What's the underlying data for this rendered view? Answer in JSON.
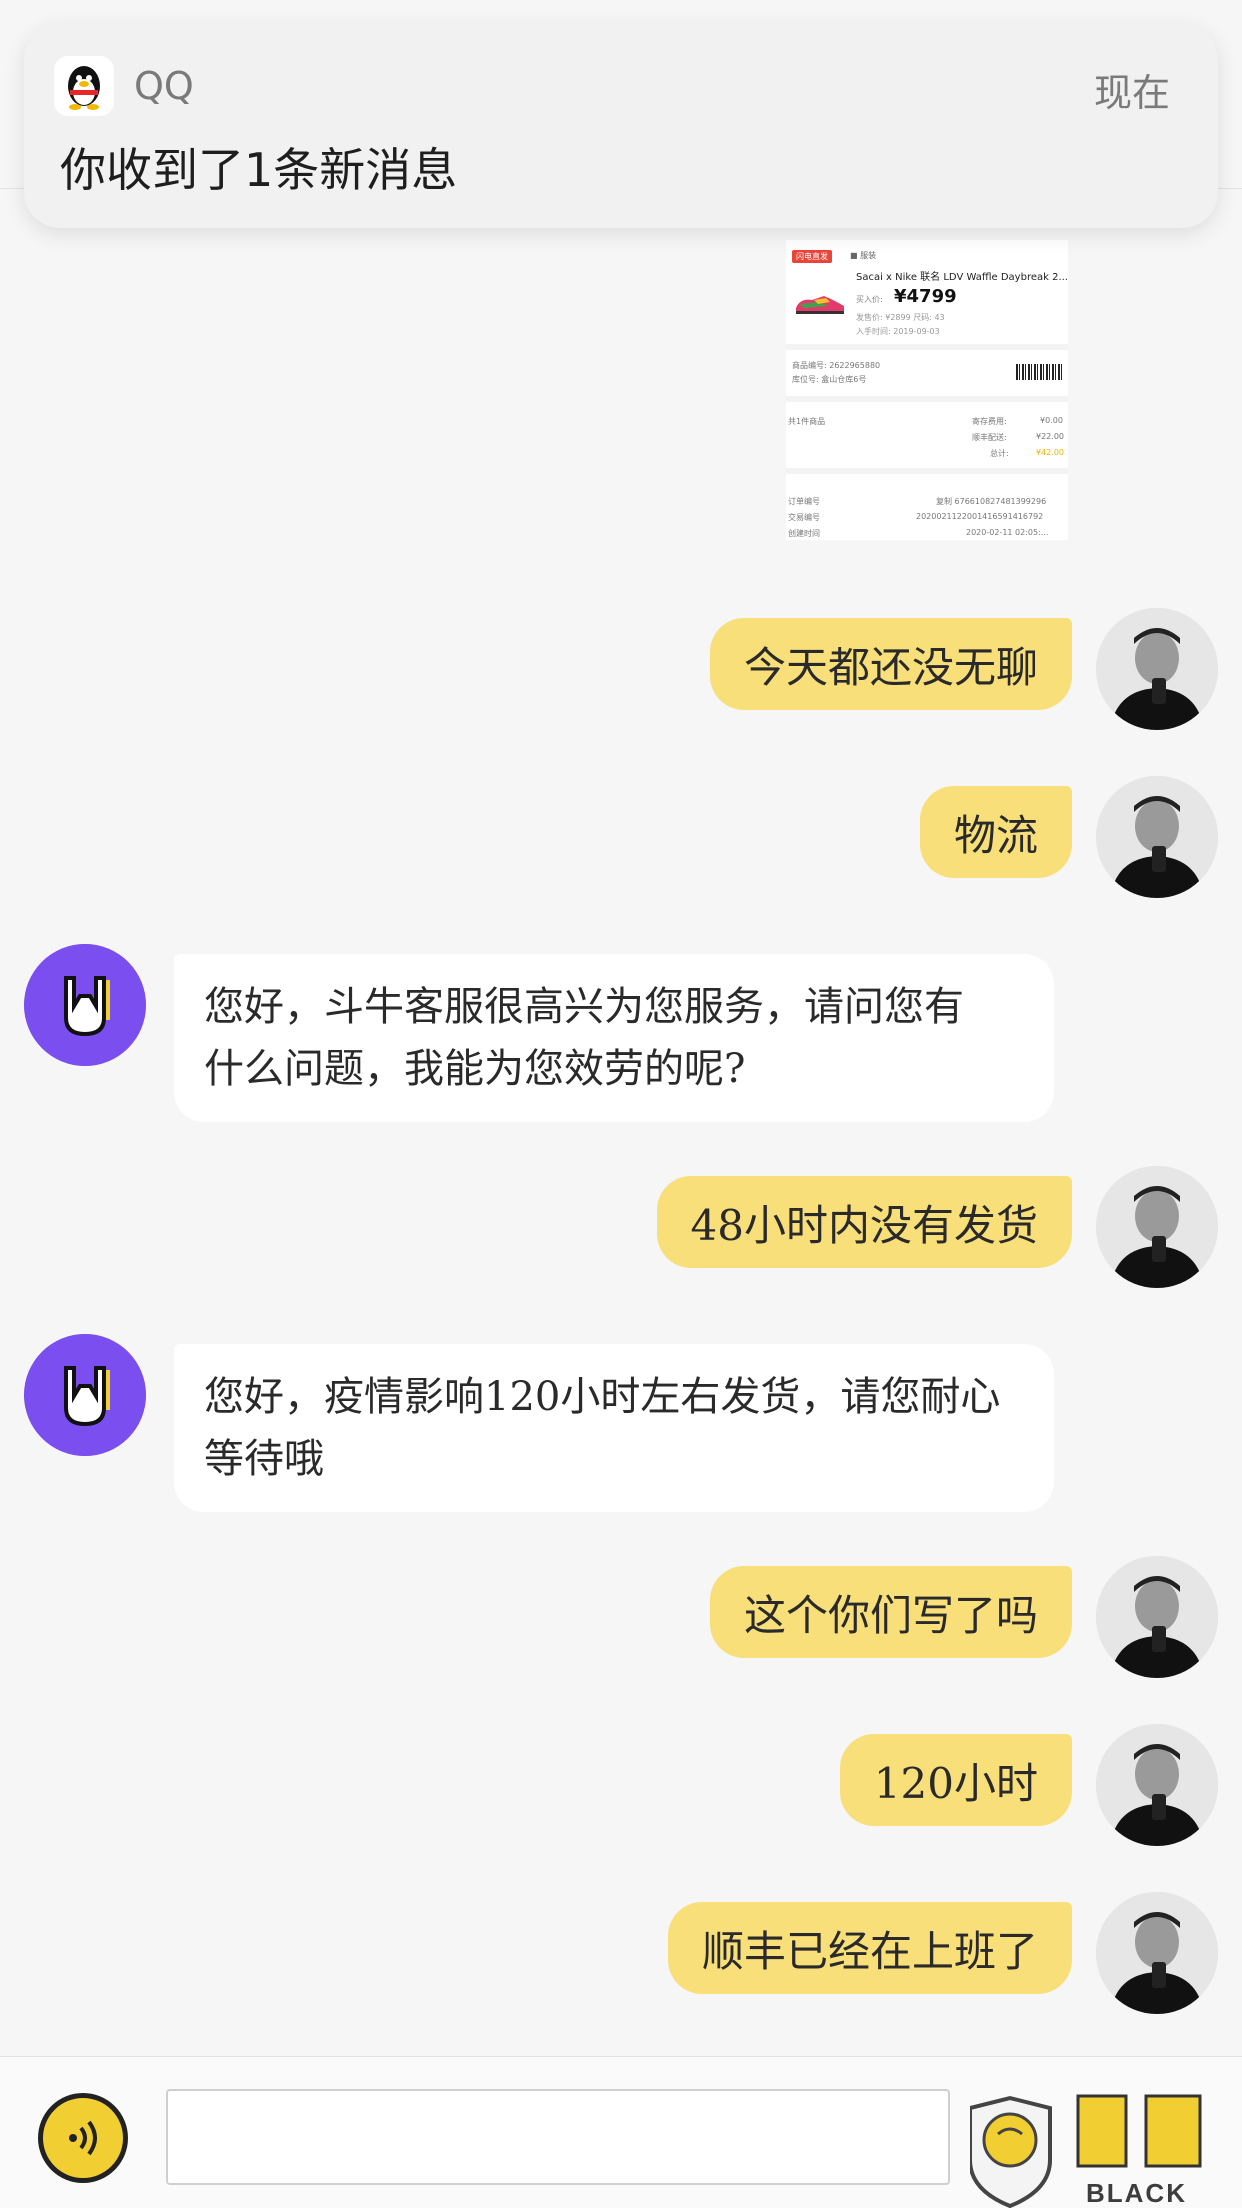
{
  "notification": {
    "app_name": "QQ",
    "time": "现在",
    "message": "你收到了1条新消息"
  },
  "order_card": {
    "tag": "闪电直发",
    "tag2": "■ 服装",
    "product_name": "Sacai x Nike 联名 LDV Waffle Daybreak 2...",
    "buy_label": "买入价:",
    "price": "¥4799",
    "meta_line1": "发售价: ¥2899    尺码: 43",
    "meta_line2": "入手时间: 2019-09-03",
    "item_no": "商品编号: 2622965880",
    "location": "库位号: 盒山仓库6号",
    "total_items": "共1件商品",
    "storage_fee_label": "寄存费用:",
    "storage_fee": "¥0.00",
    "sf_label": "顺丰配送:",
    "sf_fee": "¥22.00",
    "total_label": "总计:",
    "total": "¥42.00",
    "order_no_label": "订单编号",
    "order_no": "复制  676610827481399296",
    "trade_no_label": "交易编号",
    "trade_no": "2020021122001416591416792",
    "create_time_label": "创建时间",
    "create_time": "2020-02-11 02:05:..."
  },
  "messages": [
    {
      "from": "user",
      "text": "今天都还没无聊"
    },
    {
      "from": "user",
      "text": "物流"
    },
    {
      "from": "bot",
      "line1": "您好，斗牛客服很高兴为您服务，请问您有",
      "line2": "什么问题，我能为您效劳的呢?"
    },
    {
      "from": "user",
      "text": "48小时内没有发货"
    },
    {
      "from": "bot",
      "line1": "您好，疫情影响120小时左右发货，请您耐心",
      "line2": "等待哦"
    },
    {
      "from": "user",
      "text": "这个你们写了吗"
    },
    {
      "from": "user",
      "text": "120小时"
    },
    {
      "from": "user",
      "text": "顺丰已经在上班了"
    }
  ],
  "input": {
    "placeholder": ""
  },
  "watermark": {
    "text": "BLACK CAT"
  },
  "colors": {
    "user_bubble": "#f8df7a",
    "bot_bubble": "#ffffff",
    "bot_avatar": "#7b4ef0",
    "voice_button": "#f1cf32"
  }
}
